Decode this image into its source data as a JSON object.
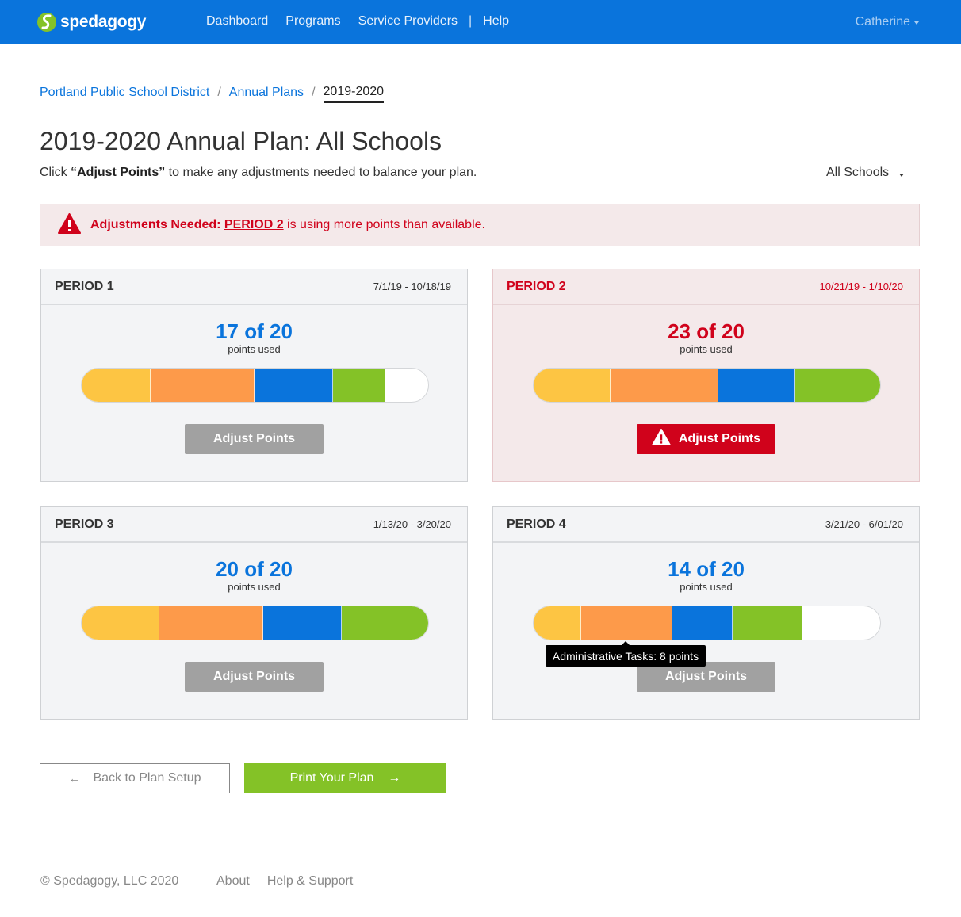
{
  "app": {
    "brand": "spedagogy",
    "brand_color": "#0a74dc"
  },
  "nav": {
    "links": [
      "Dashboard",
      "Programs",
      "Service Providers",
      "Help"
    ],
    "separator": "|",
    "user": "Catherine"
  },
  "breadcrumb": {
    "items": [
      "Portland Public School District",
      "Annual Plans"
    ],
    "current": "2019-2020",
    "separator": "/"
  },
  "page": {
    "title": "2019-2020 Annual Plan: All Schools",
    "subtitle_prefix": "Click ",
    "subtitle_bold": "“Adjust Points”",
    "subtitle_suffix": " to make any adjustments needed to balance your plan.",
    "school_filter": "All Schools"
  },
  "alert": {
    "strong": "Adjustments Needed:",
    "link": "PERIOD 2",
    "text": " is using more points than available.",
    "color": "#d0021b"
  },
  "segment_colors": [
    "#fdc543",
    "#fd9a4a",
    "#0a74dc",
    "#84c227"
  ],
  "periods": [
    {
      "title": "PERIOD 1",
      "dates": "7/1/19 - 10/18/19",
      "used_text": "17 of 20",
      "label": "points used",
      "button": "Adjust Points",
      "segments": [
        4,
        6,
        4.5,
        3
      ],
      "total": 20,
      "warning": false
    },
    {
      "title": "PERIOD 2",
      "dates": "10/21/19 - 1/10/20",
      "used_text": "23 of 20",
      "label": "points used",
      "button": "Adjust Points",
      "segments": [
        5,
        7,
        5,
        5.5
      ],
      "total": 22.5,
      "warning": true
    },
    {
      "title": "PERIOD 3",
      "dates": "1/13/20 - 3/20/20",
      "used_text": "20 of 20",
      "label": "points used",
      "button": "Adjust Points",
      "segments": [
        4.5,
        6,
        4.5,
        5
      ],
      "total": 20,
      "warning": false
    },
    {
      "title": "PERIOD 4",
      "dates": "3/21/20 - 6/01/20",
      "used_text": "14 of 20",
      "label": "points used",
      "button": "Adjust Points",
      "segments": [
        2.75,
        5.25,
        3.5,
        4
      ],
      "total": 20,
      "warning": false
    }
  ],
  "tooltip": {
    "text": "Administrative Tasks: 8 points"
  },
  "actions": {
    "back": "Back to Plan Setup",
    "print": "Print Your Plan"
  },
  "footer": {
    "copyright": "© Spedagogy, LLC 2020",
    "links": [
      "About",
      "Help & Support"
    ]
  }
}
